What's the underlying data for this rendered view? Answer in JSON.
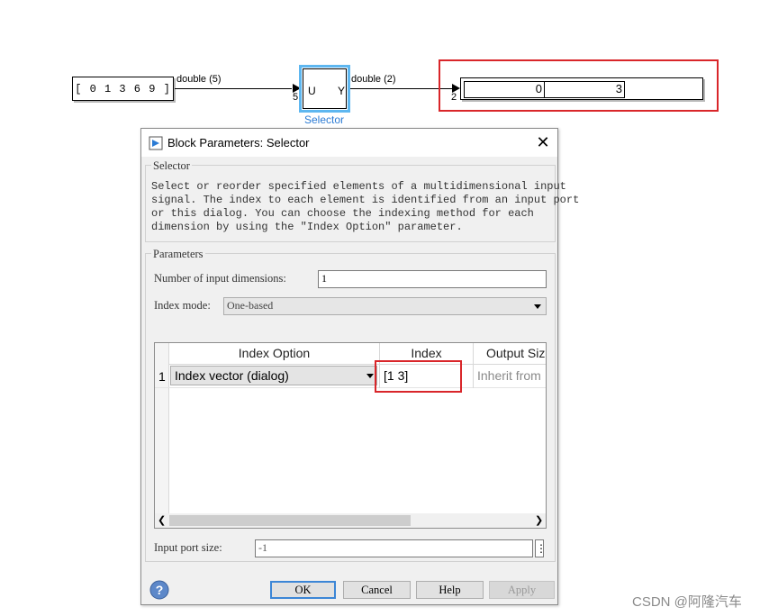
{
  "canvas": {
    "constant_value": "[ 0 1 3 6 9 ]",
    "signal_in_label": "double (5)",
    "signal_out_label": "double (2)",
    "in_port_width": "5",
    "out_port_width": "2",
    "selector_in_port": "U",
    "selector_out_port": "Y",
    "selector_name": "Selector",
    "display_values": [
      "0",
      "3"
    ]
  },
  "dialog": {
    "title": "Block Parameters: Selector",
    "close_glyph": "✕",
    "description_group": "Selector",
    "description_lines": [
      "Select or reorder specified elements of a multidimensional input",
      "signal. The index to each element is identified from an input port",
      "or this dialog. You can choose the indexing method for each",
      "dimension by using the \"Index Option\" parameter."
    ],
    "parameters_group": "Parameters",
    "num_dims_label": "Number of input dimensions:",
    "num_dims_value": "1",
    "index_mode_label": "Index mode:",
    "index_mode_value": "One-based",
    "table": {
      "headers": [
        "Index Option",
        "Index",
        "Output Siz"
      ],
      "rows": [
        {
          "num": "1",
          "option": "Index vector (dialog)",
          "index": "[1 3]",
          "output_size": "Inherit from"
        }
      ]
    },
    "input_port_size_label": "Input port size:",
    "input_port_size_value": "-1",
    "buttons": {
      "ok": "OK",
      "cancel": "Cancel",
      "help": "Help",
      "apply": "Apply"
    }
  },
  "watermark": "CSDN @阿隆汽车",
  "colors": {
    "accent": "#5eb7f0",
    "highlight": "#d9262a",
    "selector_name": "#2b7bd4"
  }
}
